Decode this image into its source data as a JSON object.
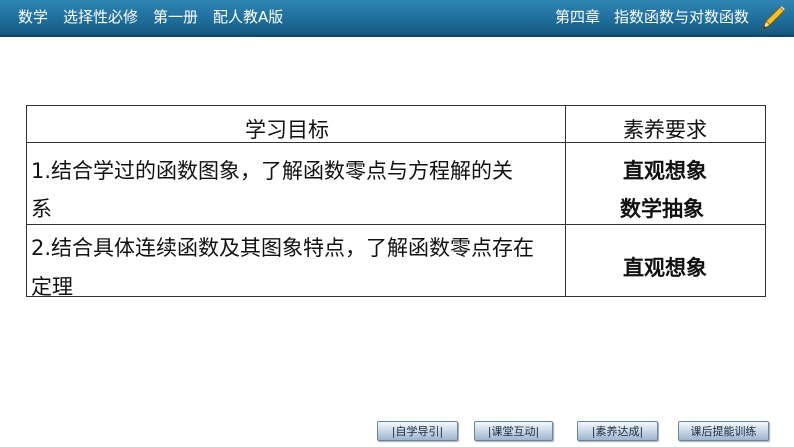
{
  "header": {
    "left": [
      "数学",
      "选择性必修",
      "第一册",
      "配人教A版"
    ],
    "chapter": "第四章",
    "section_title": "指数函数与对数函数"
  },
  "table": {
    "headers": [
      "学习目标",
      "素养要求"
    ],
    "rows": [
      {
        "goal_line1": "1.结合学过的函数图象，了解函数零点与方程解的关",
        "goal_line2": "系",
        "req_line1": "直观想象",
        "req_line2": "数学抽象"
      },
      {
        "goal_line1": "2.结合具体连续函数及其图象特点，了解函数零点存在",
        "goal_line2": "定理",
        "req_line1": "直观想象"
      }
    ]
  },
  "nav": [
    "|自学导引|",
    "|课堂互动|",
    "|素养达成|",
    "课后提能训练"
  ],
  "colors": {
    "header_bg": "#1f6e9c",
    "nav_bg": "#c9d8e6"
  }
}
